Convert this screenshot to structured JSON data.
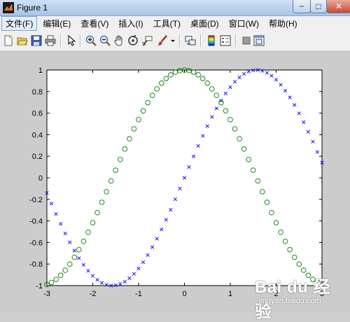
{
  "window": {
    "title": "Figure 1",
    "controls": {
      "minimize": "−",
      "maximize": "□",
      "close": "✕"
    }
  },
  "menu": [
    {
      "label": "文件(F)",
      "name": "menu-file"
    },
    {
      "label": "编辑(E)",
      "name": "menu-edit"
    },
    {
      "label": "查看(V)",
      "name": "menu-view"
    },
    {
      "label": "插入(I)",
      "name": "menu-insert"
    },
    {
      "label": "工具(T)",
      "name": "menu-tools"
    },
    {
      "label": "桌面(D)",
      "name": "menu-desktop"
    },
    {
      "label": "窗口(W)",
      "name": "menu-window"
    },
    {
      "label": "帮助(H)",
      "name": "menu-help"
    }
  ],
  "toolbar": [
    "new-figure-icon",
    "open-file-icon",
    "save-icon",
    "print-icon",
    "pointer-icon",
    "zoom-in-icon",
    "zoom-out-icon",
    "pan-hand-icon",
    "rotate-3d-icon",
    "data-cursor-icon",
    "brush-icon",
    "brush-dropdown-icon",
    "link-plot-icon",
    "insert-colorbar-icon",
    "insert-legend-icon",
    "hide-plot-tools-icon",
    "show-plot-tools-icon"
  ],
  "watermark": {
    "logo": "Bai du 经验",
    "url": "jingyan.baidu.com"
  },
  "chart_data": {
    "type": "scatter",
    "xlim": [
      -3,
      3
    ],
    "ylim": [
      -1,
      1
    ],
    "xticks": [
      "-3",
      "-2",
      "-1",
      "0",
      "1",
      "2",
      "3"
    ],
    "yticks": [
      "-1",
      "-0.8",
      "-0.6",
      "-0.4",
      "-0.2",
      "0",
      "0.2",
      "0.4",
      "0.6",
      "0.8",
      "1"
    ],
    "grid": false,
    "x": [
      -3.0,
      -2.9,
      -2.8,
      -2.7,
      -2.6,
      -2.5,
      -2.4,
      -2.3,
      -2.2,
      -2.1,
      -2.0,
      -1.9,
      -1.8,
      -1.7,
      -1.6,
      -1.5,
      -1.4,
      -1.3,
      -1.2,
      -1.1,
      -1.0,
      -0.9,
      -0.8,
      -0.7,
      -0.6,
      -0.5,
      -0.4,
      -0.3,
      -0.2,
      -0.1,
      0.0,
      0.1,
      0.2,
      0.3,
      0.4,
      0.5,
      0.6,
      0.7,
      0.8,
      0.9,
      1.0,
      1.1,
      1.2,
      1.3,
      1.4,
      1.5,
      1.6,
      1.7,
      1.8,
      1.9,
      2.0,
      2.1,
      2.2,
      2.3,
      2.4,
      2.5,
      2.6,
      2.7,
      2.8,
      2.9,
      3.0
    ],
    "series": [
      {
        "marker": "x",
        "color": "#0000ff",
        "values": [
          -0.141,
          -0.239,
          -0.335,
          -0.427,
          -0.516,
          -0.598,
          -0.675,
          -0.746,
          -0.808,
          -0.863,
          -0.909,
          -0.946,
          -0.974,
          -0.992,
          -1.0,
          -0.997,
          -0.985,
          -0.964,
          -0.932,
          -0.891,
          -0.841,
          -0.783,
          -0.717,
          -0.644,
          -0.565,
          -0.479,
          -0.389,
          -0.296,
          -0.199,
          -0.1,
          0.0,
          0.1,
          0.199,
          0.296,
          0.389,
          0.479,
          0.565,
          0.644,
          0.717,
          0.783,
          0.841,
          0.891,
          0.932,
          0.964,
          0.985,
          0.997,
          1.0,
          0.992,
          0.974,
          0.946,
          0.909,
          0.863,
          0.808,
          0.746,
          0.675,
          0.598,
          0.516,
          0.427,
          0.335,
          0.239,
          0.141
        ]
      },
      {
        "marker": "o",
        "color": "#008000",
        "values": [
          -0.99,
          -0.971,
          -0.942,
          -0.904,
          -0.857,
          -0.801,
          -0.737,
          -0.666,
          -0.589,
          -0.505,
          -0.416,
          -0.323,
          -0.227,
          -0.129,
          -0.029,
          0.071,
          0.17,
          0.267,
          0.362,
          0.454,
          0.54,
          0.622,
          0.697,
          0.765,
          0.825,
          0.878,
          0.921,
          0.955,
          0.98,
          0.995,
          1.0,
          0.995,
          0.98,
          0.955,
          0.921,
          0.878,
          0.825,
          0.765,
          0.697,
          0.622,
          0.54,
          0.454,
          0.362,
          0.267,
          0.17,
          0.071,
          -0.029,
          -0.129,
          -0.227,
          -0.323,
          -0.416,
          -0.505,
          -0.589,
          -0.666,
          -0.737,
          -0.801,
          -0.857,
          -0.904,
          -0.942,
          -0.971,
          -0.99
        ]
      }
    ]
  }
}
